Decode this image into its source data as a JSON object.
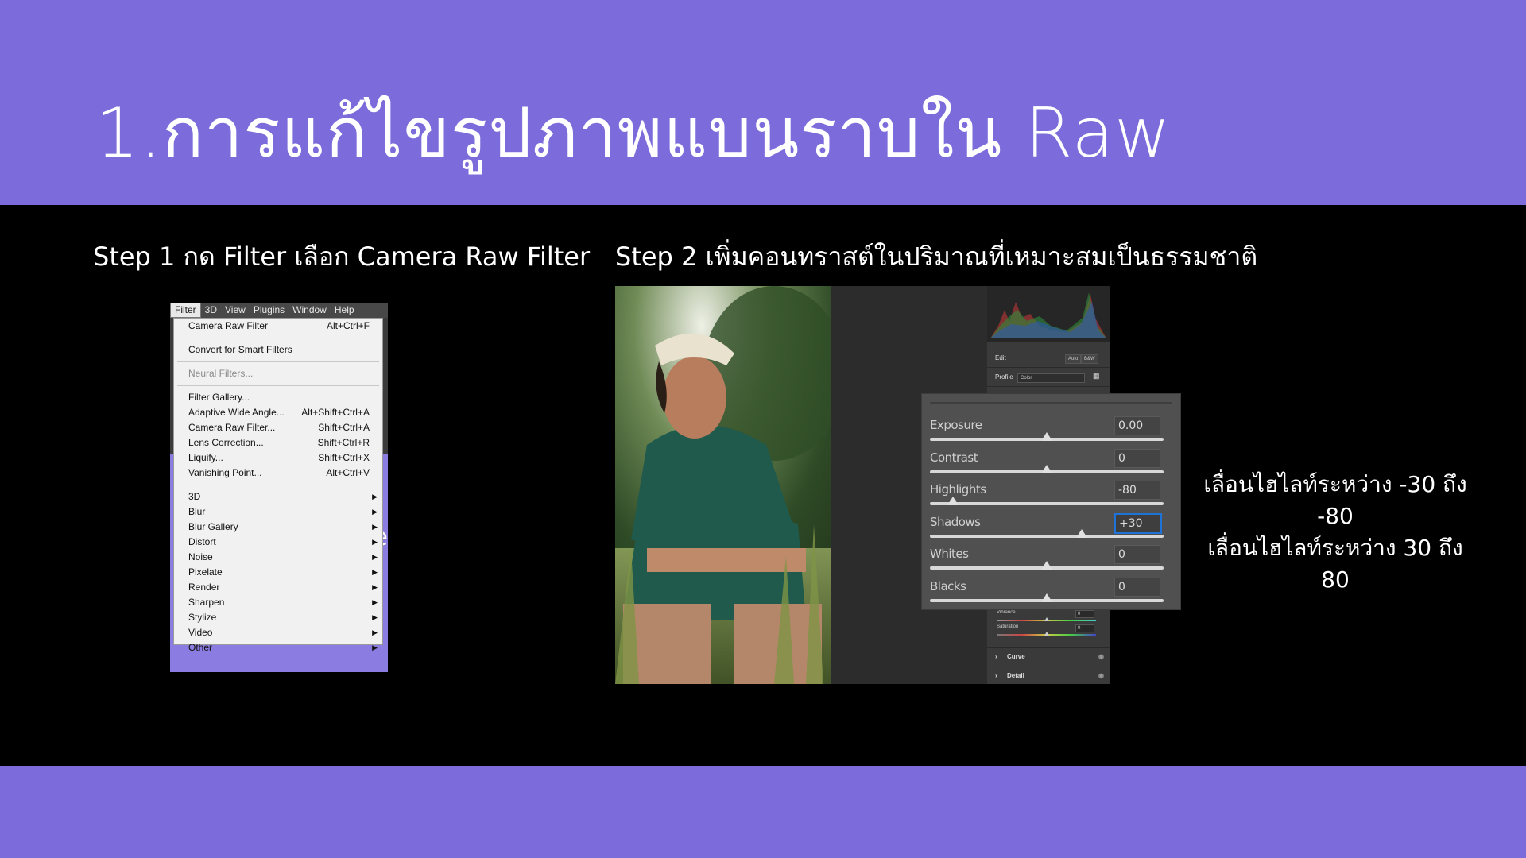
{
  "slide": {
    "title": "1.การแก้ไขรูปภาพแบนราบใน Raw",
    "step1": "Step 1 กด Filter เลือก Camera Raw Filter",
    "step2": "Step 2 เพิ่มคอนทราสต์ในปริมาณที่เหมาะสมเป็นธรรมชาติ",
    "note_line1": "เลื่อนไฮไลท์ระหว่าง -30 ถึง -80",
    "note_line2": "เลื่อนไฮไลท์ระหว่าง 30 ถึง 80",
    "colors": {
      "band": "#7b6bdb",
      "background": "#000000"
    }
  },
  "menubar": {
    "items": [
      "Filter",
      "3D",
      "View",
      "Plugins",
      "Window",
      "Help"
    ],
    "active": "Filter"
  },
  "filter_menu": {
    "group1": [
      {
        "label": "Camera Raw Filter",
        "shortcut": "Alt+Ctrl+F"
      }
    ],
    "group2": [
      {
        "label": "Convert for Smart Filters"
      }
    ],
    "group3": [
      {
        "label": "Neural Filters...",
        "disabled": true
      }
    ],
    "group4": [
      {
        "label": "Filter Gallery...",
        "shortcut": ""
      },
      {
        "label": "Adaptive Wide Angle...",
        "shortcut": "Alt+Shift+Ctrl+A"
      },
      {
        "label": "Camera Raw Filter...",
        "shortcut": "Shift+Ctrl+A"
      },
      {
        "label": "Lens Correction...",
        "shortcut": "Shift+Ctrl+R"
      },
      {
        "label": "Liquify...",
        "shortcut": "Shift+Ctrl+X"
      },
      {
        "label": "Vanishing Point...",
        "shortcut": "Alt+Ctrl+V"
      }
    ],
    "submenus": [
      "3D",
      "Blur",
      "Blur Gallery",
      "Distort",
      "Noise",
      "Pixelate",
      "Render",
      "Sharpen",
      "Stylize",
      "Video",
      "Other"
    ],
    "side_glyph": "e"
  },
  "camera_raw": {
    "edit_label": "Edit",
    "auto_label": "Auto",
    "bw_label": "B&W",
    "profile_label": "Profile",
    "profile_value": "Color",
    "sliders": [
      {
        "label": "Exposure",
        "value": "0.00",
        "level": 0.5
      },
      {
        "label": "Contrast",
        "value": "0",
        "level": 0.5
      },
      {
        "label": "Highlights",
        "value": "-80",
        "level": 0.1
      },
      {
        "label": "Shadows",
        "value": "+30",
        "level": 0.65,
        "focused": true
      },
      {
        "label": "Whites",
        "value": "0",
        "level": 0.5
      },
      {
        "label": "Blacks",
        "value": "0",
        "level": 0.5
      }
    ],
    "mini_sliders": [
      {
        "label": "Vibrance",
        "value": "0",
        "level": 0.5
      },
      {
        "label": "Saturation",
        "value": "0",
        "level": 0.5
      }
    ],
    "sections": [
      "Curve",
      "Detail"
    ]
  }
}
